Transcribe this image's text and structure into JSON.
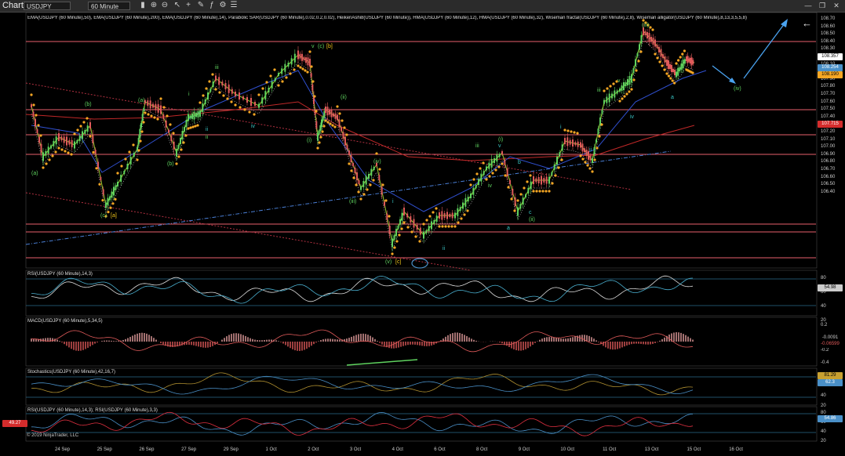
{
  "toolbar": {
    "title": "Chart",
    "symbol": "USDJPY",
    "interval": "60 Minute",
    "close_symbol": "✕",
    "min_symbol": "—",
    "max_symbol": "❐"
  },
  "panels": {
    "price_title": "EMA(USDJPY (60 Minute),50), EMA(USDJPY (60 Minute),200), EMA(USDJPY (60 Minute),14), Parabolic SAR(USDJPY (60 Minute),0.02,0.2,0.02), HeikenAshi8(USDJPY (60 Minute)), HMA(USDJPY (60 Minute),12), HMA(USDJPY (60 Minute),32), Wiseman fractal(USDJPY (60 Minute),2,8), Wiseman alligator(USDJPY (60 Minute),8,13,3,5,5,8)",
    "rsi_title": "RSI(USDJPY (60 Minute),14,3)",
    "macd_title": "MACD(USDJPY (60 Minute),5,34,5)",
    "stoch_title": "Stochastics(USDJPY (60 Minute),42,16,7)",
    "rsi2_title": "RSI(USDJPY (60 Minute),14,3); RSI(USDJPY (60 Minute),3,3)",
    "copyright": "© 2019 NinjaTrader, LLC"
  },
  "price_axis": [
    "108.70",
    "108.60",
    "108.50",
    "108.40",
    "108.30",
    "108.20",
    "108.10",
    "108.00",
    "107.90",
    "107.80",
    "107.70",
    "107.60",
    "107.50",
    "107.40",
    "107.30",
    "107.20",
    "107.10",
    "107.00",
    "106.90",
    "106.80",
    "106.70",
    "106.60",
    "106.50",
    "106.40"
  ],
  "price_tags": {
    "last": "108.357",
    "alligator": "108.254",
    "sar": "108.190",
    "ema200": "107.715",
    "hma_a": "108.34",
    "hma_b": "108.32"
  },
  "rsi_axis": [
    "80",
    "60",
    "40",
    "20"
  ],
  "rsi_tag": "54.98",
  "macd_axis": [
    "0.2",
    "0",
    "-0.2",
    "-0.4"
  ],
  "macd_tags": {
    "a": "-0.0091",
    "b": "-0.06599"
  },
  "stoch_axis": [
    "80",
    "60",
    "40",
    "20"
  ],
  "stoch_tags": {
    "a": "81.29",
    "b": "62.3"
  },
  "rsi2_axis": [
    "80",
    "60",
    "40",
    "20"
  ],
  "rsi2_tags": {
    "left": "49.27",
    "right": "54.86"
  },
  "dates": [
    "24 Sep",
    "25 Sep",
    "26 Sep",
    "27 Sep",
    "29 Sep",
    "1 Oct",
    "2 Oct",
    "3 Oct",
    "4 Oct",
    "6 Oct",
    "8 Oct",
    "9 Oct",
    "10 Oct",
    "11 Oct",
    "13 Oct",
    "15 Oct",
    "16 Oct"
  ],
  "waves": [
    {
      "t": "(a)",
      "c": "#5fd35f"
    },
    {
      "t": "(b)",
      "c": "#5fd35f"
    },
    {
      "t": "(c)",
      "c": "#5fd35f"
    },
    {
      "t": "[a]",
      "c": "#f0c419"
    },
    {
      "t": "(a)",
      "c": "#5fd35f"
    },
    {
      "t": "(b)",
      "c": "#5fd35f"
    },
    {
      "t": "i",
      "c": "#5fd35f"
    },
    {
      "t": "ii",
      "c": "#5fd35f"
    },
    {
      "t": "iii",
      "c": "#5fd35f"
    },
    {
      "t": "ii",
      "c": "#39c6c6"
    },
    {
      "t": "iv",
      "c": "#39c6c6"
    },
    {
      "t": "v",
      "c": "#5fd35f"
    },
    {
      "t": "(c)",
      "c": "#5fd35f"
    },
    {
      "t": "[b]",
      "c": "#f0c419"
    },
    {
      "t": "(i)",
      "c": "#5fd35f"
    },
    {
      "t": "(ii)",
      "c": "#5fd35f"
    },
    {
      "t": "(iii)",
      "c": "#5fd35f"
    },
    {
      "t": "(iv)",
      "c": "#5fd35f"
    },
    {
      "t": "(v)",
      "c": "#5fd35f"
    },
    {
      "t": "[c]",
      "c": "#f0c419"
    },
    {
      "t": "i",
      "c": "#39c6c6"
    },
    {
      "t": "ii",
      "c": "#39c6c6"
    },
    {
      "t": "iii",
      "c": "#5fd35f"
    },
    {
      "t": "iv",
      "c": "#5fd35f"
    },
    {
      "t": "(i)",
      "c": "#5fd35f"
    },
    {
      "t": "v",
      "c": "#39c6c6"
    },
    {
      "t": "b",
      "c": "#39c6c6"
    },
    {
      "t": "a",
      "c": "#39c6c6"
    },
    {
      "t": "c",
      "c": "#39c6c6"
    },
    {
      "t": "(ii)",
      "c": "#5fd35f"
    },
    {
      "t": "i",
      "c": "#39c6c6"
    },
    {
      "t": "ii",
      "c": "#39c6c6"
    },
    {
      "t": "iii",
      "c": "#5fd35f"
    },
    {
      "t": "iv",
      "c": "#39c6c6"
    },
    {
      "t": "v",
      "c": "#5fd35f"
    },
    {
      "t": "(iii)",
      "c": "#5fd35f"
    },
    {
      "t": "a",
      "c": "#39c6c6"
    },
    {
      "t": "(iv)",
      "c": "#5fd35f"
    }
  ],
  "colors": {
    "background": "#000000",
    "hline": "#e8606c",
    "up": "#5fd35f",
    "down": "#e05a5a",
    "sar": "#f5a623",
    "forecast": "#4aa3f0"
  }
}
